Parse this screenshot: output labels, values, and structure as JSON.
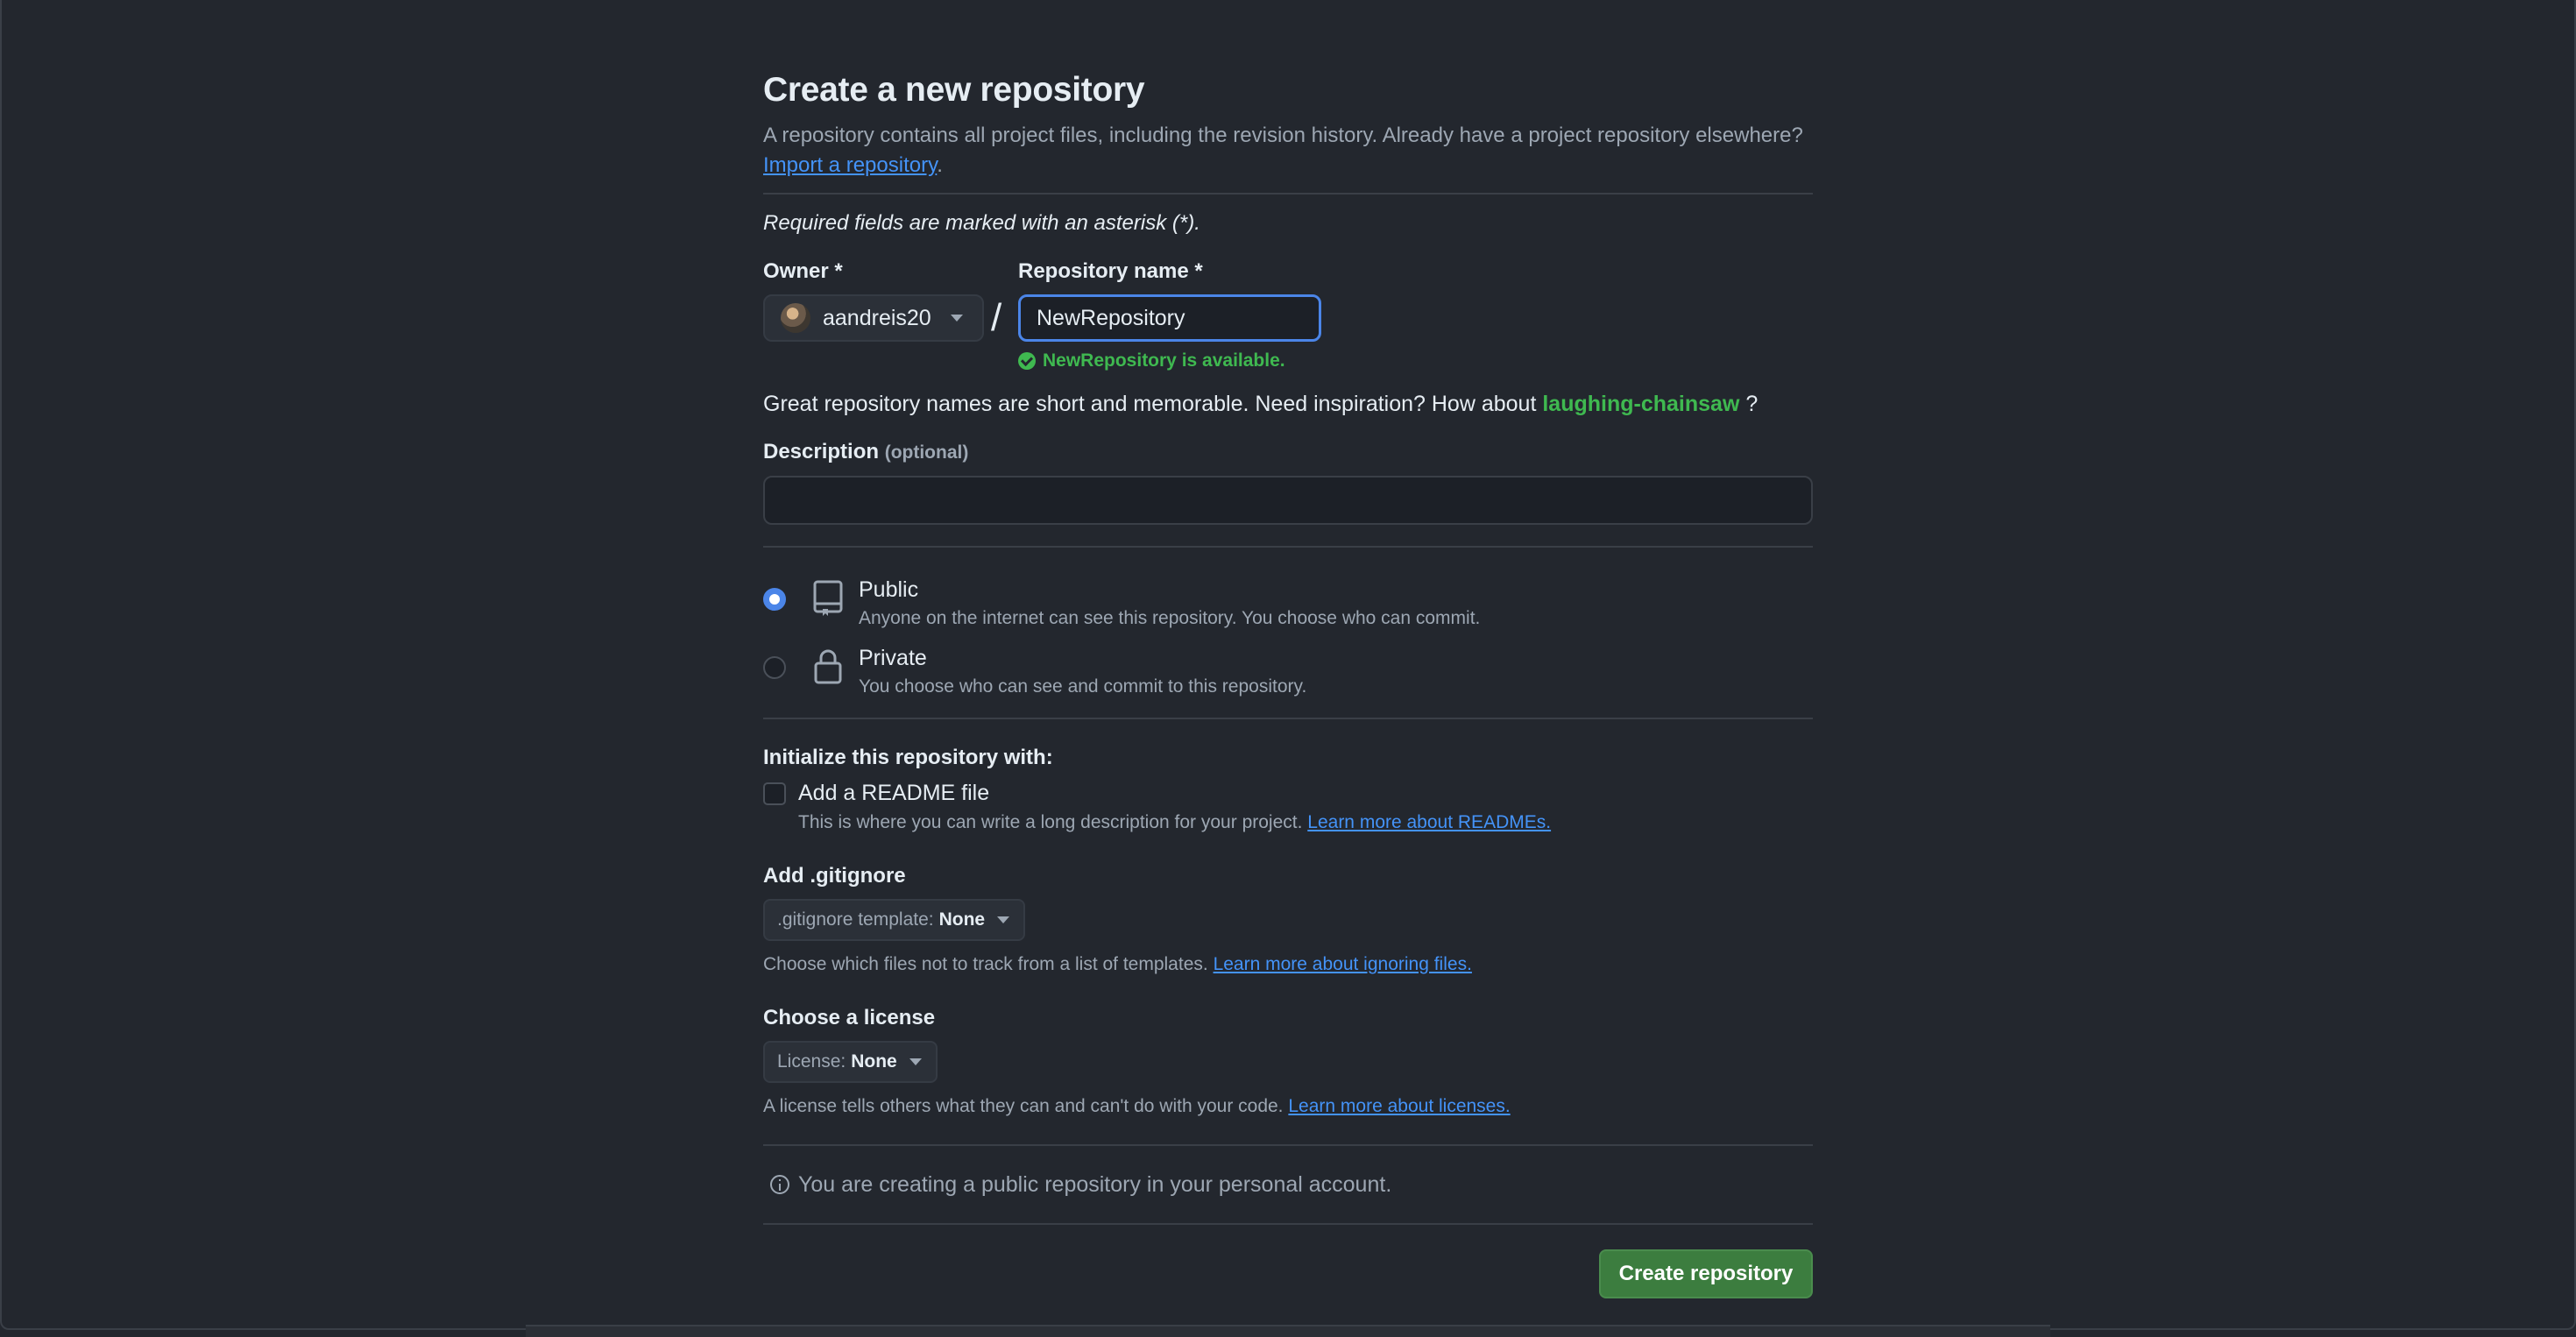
{
  "page": {
    "title": "Create a new repository",
    "subtitle_prefix": "A repository contains all project files, including the revision history. Already have a project repository elsewhere?",
    "import_link": "Import a repository",
    "subtitle_suffix": ".",
    "required_note": "Required fields are marked with an asterisk (*)."
  },
  "owner": {
    "label": "Owner *",
    "value": "aandreis20"
  },
  "repo": {
    "label": "Repository name *",
    "value": "NewRepository",
    "availability": "NewRepository is available."
  },
  "inspiration": {
    "text": "Great repository names are short and memorable. Need inspiration? How about",
    "suggestion": "laughing-chainsaw",
    "suffix": "?"
  },
  "description": {
    "label": "Description",
    "optional": "(optional)",
    "value": "",
    "placeholder": ""
  },
  "visibility": {
    "selected": "Public",
    "options": [
      {
        "title": "Public",
        "desc": "Anyone on the internet can see this repository. You choose who can commit.",
        "icon": "repo-icon"
      },
      {
        "title": "Private",
        "desc": "You choose who can see and commit to this repository.",
        "icon": "lock-icon"
      }
    ]
  },
  "init": {
    "heading": "Initialize this repository with:",
    "readme_label": "Add a README file",
    "readme_checked": false,
    "readme_desc": "This is where you can write a long description for your project.",
    "readme_link": "Learn more about READMEs."
  },
  "gitignore": {
    "heading": "Add .gitignore",
    "select_prefix": ".gitignore template:",
    "select_value": "None",
    "help": "Choose which files not to track from a list of templates.",
    "help_link": "Learn more about ignoring files."
  },
  "license": {
    "heading": "Choose a license",
    "select_prefix": "License:",
    "select_value": "None",
    "help": "A license tells others what they can and can't do with your code.",
    "help_link": "Learn more about licenses."
  },
  "notice": {
    "text": "You are creating a public repository in your personal account."
  },
  "submit": {
    "label": "Create repository",
    "color": "#3c7d3f"
  }
}
